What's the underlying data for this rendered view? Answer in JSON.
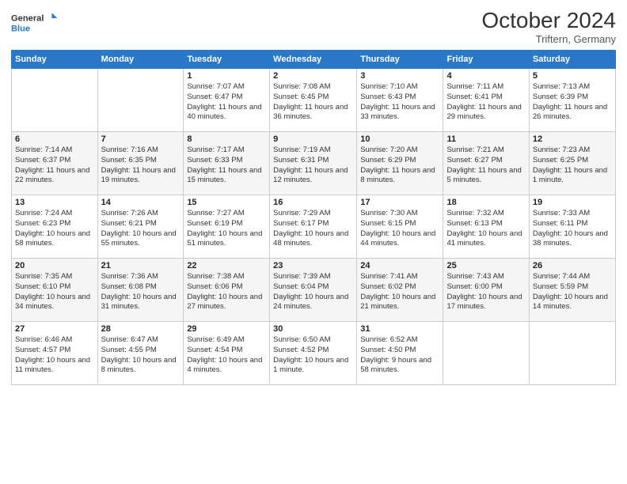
{
  "header": {
    "logo_line1": "General",
    "logo_line2": "Blue",
    "month_year": "October 2024",
    "location": "Triftern, Germany"
  },
  "weekdays": [
    "Sunday",
    "Monday",
    "Tuesday",
    "Wednesday",
    "Thursday",
    "Friday",
    "Saturday"
  ],
  "weeks": [
    [
      {
        "day": "",
        "sunrise": "",
        "sunset": "",
        "daylight": ""
      },
      {
        "day": "",
        "sunrise": "",
        "sunset": "",
        "daylight": ""
      },
      {
        "day": "1",
        "sunrise": "Sunrise: 7:07 AM",
        "sunset": "Sunset: 6:47 PM",
        "daylight": "Daylight: 11 hours and 40 minutes."
      },
      {
        "day": "2",
        "sunrise": "Sunrise: 7:08 AM",
        "sunset": "Sunset: 6:45 PM",
        "daylight": "Daylight: 11 hours and 36 minutes."
      },
      {
        "day": "3",
        "sunrise": "Sunrise: 7:10 AM",
        "sunset": "Sunset: 6:43 PM",
        "daylight": "Daylight: 11 hours and 33 minutes."
      },
      {
        "day": "4",
        "sunrise": "Sunrise: 7:11 AM",
        "sunset": "Sunset: 6:41 PM",
        "daylight": "Daylight: 11 hours and 29 minutes."
      },
      {
        "day": "5",
        "sunrise": "Sunrise: 7:13 AM",
        "sunset": "Sunset: 6:39 PM",
        "daylight": "Daylight: 11 hours and 26 minutes."
      }
    ],
    [
      {
        "day": "6",
        "sunrise": "Sunrise: 7:14 AM",
        "sunset": "Sunset: 6:37 PM",
        "daylight": "Daylight: 11 hours and 22 minutes."
      },
      {
        "day": "7",
        "sunrise": "Sunrise: 7:16 AM",
        "sunset": "Sunset: 6:35 PM",
        "daylight": "Daylight: 11 hours and 19 minutes."
      },
      {
        "day": "8",
        "sunrise": "Sunrise: 7:17 AM",
        "sunset": "Sunset: 6:33 PM",
        "daylight": "Daylight: 11 hours and 15 minutes."
      },
      {
        "day": "9",
        "sunrise": "Sunrise: 7:19 AM",
        "sunset": "Sunset: 6:31 PM",
        "daylight": "Daylight: 11 hours and 12 minutes."
      },
      {
        "day": "10",
        "sunrise": "Sunrise: 7:20 AM",
        "sunset": "Sunset: 6:29 PM",
        "daylight": "Daylight: 11 hours and 8 minutes."
      },
      {
        "day": "11",
        "sunrise": "Sunrise: 7:21 AM",
        "sunset": "Sunset: 6:27 PM",
        "daylight": "Daylight: 11 hours and 5 minutes."
      },
      {
        "day": "12",
        "sunrise": "Sunrise: 7:23 AM",
        "sunset": "Sunset: 6:25 PM",
        "daylight": "Daylight: 11 hours and 1 minute."
      }
    ],
    [
      {
        "day": "13",
        "sunrise": "Sunrise: 7:24 AM",
        "sunset": "Sunset: 6:23 PM",
        "daylight": "Daylight: 10 hours and 58 minutes."
      },
      {
        "day": "14",
        "sunrise": "Sunrise: 7:26 AM",
        "sunset": "Sunset: 6:21 PM",
        "daylight": "Daylight: 10 hours and 55 minutes."
      },
      {
        "day": "15",
        "sunrise": "Sunrise: 7:27 AM",
        "sunset": "Sunset: 6:19 PM",
        "daylight": "Daylight: 10 hours and 51 minutes."
      },
      {
        "day": "16",
        "sunrise": "Sunrise: 7:29 AM",
        "sunset": "Sunset: 6:17 PM",
        "daylight": "Daylight: 10 hours and 48 minutes."
      },
      {
        "day": "17",
        "sunrise": "Sunrise: 7:30 AM",
        "sunset": "Sunset: 6:15 PM",
        "daylight": "Daylight: 10 hours and 44 minutes."
      },
      {
        "day": "18",
        "sunrise": "Sunrise: 7:32 AM",
        "sunset": "Sunset: 6:13 PM",
        "daylight": "Daylight: 10 hours and 41 minutes."
      },
      {
        "day": "19",
        "sunrise": "Sunrise: 7:33 AM",
        "sunset": "Sunset: 6:11 PM",
        "daylight": "Daylight: 10 hours and 38 minutes."
      }
    ],
    [
      {
        "day": "20",
        "sunrise": "Sunrise: 7:35 AM",
        "sunset": "Sunset: 6:10 PM",
        "daylight": "Daylight: 10 hours and 34 minutes."
      },
      {
        "day": "21",
        "sunrise": "Sunrise: 7:36 AM",
        "sunset": "Sunset: 6:08 PM",
        "daylight": "Daylight: 10 hours and 31 minutes."
      },
      {
        "day": "22",
        "sunrise": "Sunrise: 7:38 AM",
        "sunset": "Sunset: 6:06 PM",
        "daylight": "Daylight: 10 hours and 27 minutes."
      },
      {
        "day": "23",
        "sunrise": "Sunrise: 7:39 AM",
        "sunset": "Sunset: 6:04 PM",
        "daylight": "Daylight: 10 hours and 24 minutes."
      },
      {
        "day": "24",
        "sunrise": "Sunrise: 7:41 AM",
        "sunset": "Sunset: 6:02 PM",
        "daylight": "Daylight: 10 hours and 21 minutes."
      },
      {
        "day": "25",
        "sunrise": "Sunrise: 7:43 AM",
        "sunset": "Sunset: 6:00 PM",
        "daylight": "Daylight: 10 hours and 17 minutes."
      },
      {
        "day": "26",
        "sunrise": "Sunrise: 7:44 AM",
        "sunset": "Sunset: 5:59 PM",
        "daylight": "Daylight: 10 hours and 14 minutes."
      }
    ],
    [
      {
        "day": "27",
        "sunrise": "Sunrise: 6:46 AM",
        "sunset": "Sunset: 4:57 PM",
        "daylight": "Daylight: 10 hours and 11 minutes."
      },
      {
        "day": "28",
        "sunrise": "Sunrise: 6:47 AM",
        "sunset": "Sunset: 4:55 PM",
        "daylight": "Daylight: 10 hours and 8 minutes."
      },
      {
        "day": "29",
        "sunrise": "Sunrise: 6:49 AM",
        "sunset": "Sunset: 4:54 PM",
        "daylight": "Daylight: 10 hours and 4 minutes."
      },
      {
        "day": "30",
        "sunrise": "Sunrise: 6:50 AM",
        "sunset": "Sunset: 4:52 PM",
        "daylight": "Daylight: 10 hours and 1 minute."
      },
      {
        "day": "31",
        "sunrise": "Sunrise: 6:52 AM",
        "sunset": "Sunset: 4:50 PM",
        "daylight": "Daylight: 9 hours and 58 minutes."
      },
      {
        "day": "",
        "sunrise": "",
        "sunset": "",
        "daylight": ""
      },
      {
        "day": "",
        "sunrise": "",
        "sunset": "",
        "daylight": ""
      }
    ]
  ]
}
